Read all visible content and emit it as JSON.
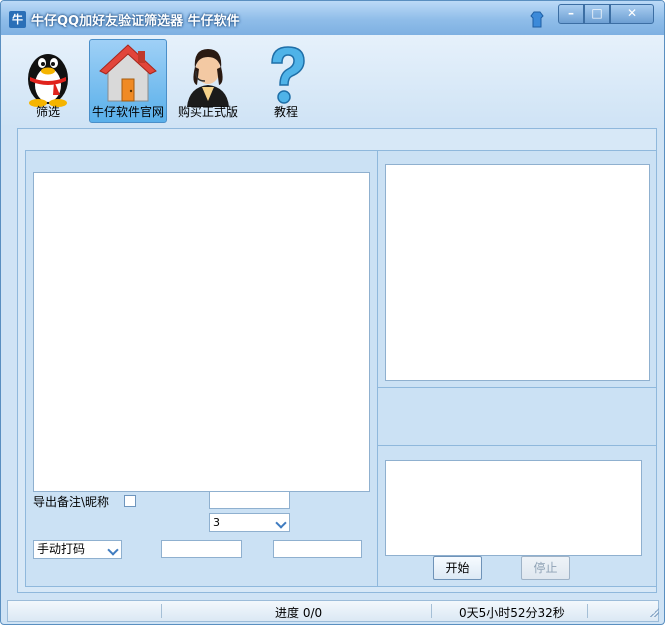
{
  "window": {
    "title": "牛仔QQ加好友验证筛选器  牛仔软件",
    "icon_text": "牛"
  },
  "toolbar": {
    "items": [
      {
        "label": "筛选",
        "icon": "qq-penguin-icon"
      },
      {
        "label": "牛仔软件官网",
        "icon": "home-icon",
        "active": true
      },
      {
        "label": "购买正式版",
        "icon": "customer-service-icon"
      },
      {
        "label": "教程",
        "icon": "help-question-icon"
      }
    ]
  },
  "form": {
    "export_label": "导出备注\\昵称",
    "export_checked": false,
    "field_top_value": "",
    "dropdown_count": "3",
    "captcha_mode": "手动打码",
    "field_a_value": "",
    "field_b_value": ""
  },
  "buttons": {
    "start": "开始",
    "stop": "停止"
  },
  "status": {
    "progress": "进度 0/0",
    "time": "0天5小时52分32秒"
  },
  "colors": {
    "accent": "#5ab0ea",
    "frame": "#5a8fc0",
    "panel": "#cbe1f4"
  }
}
